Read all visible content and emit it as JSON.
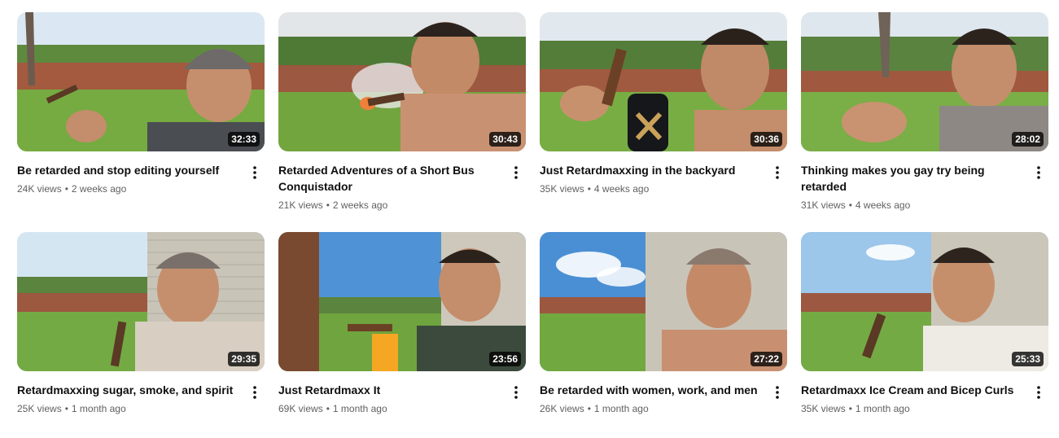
{
  "videos": [
    {
      "title": "Be retarded and stop editing yourself",
      "views": "24K views",
      "age": "2 weeks ago",
      "duration": "32:33",
      "scene": "fence"
    },
    {
      "title": "Retarded Adventures of a Short Bus Conquistador",
      "views": "21K views",
      "age": "2 weeks ago",
      "duration": "30:43",
      "scene": "fence"
    },
    {
      "title": "Just Retardmaxxing in the backyard",
      "views": "35K views",
      "age": "4 weeks ago",
      "duration": "30:36",
      "scene": "fence"
    },
    {
      "title": "Thinking makes you gay try being retarded",
      "views": "31K views",
      "age": "4 weeks ago",
      "duration": "28:02",
      "scene": "fence"
    },
    {
      "title": "Retardmaxxing sugar, smoke, and spirit",
      "views": "25K views",
      "age": "1 month ago",
      "duration": "29:35",
      "scene": "shed"
    },
    {
      "title": "Just Retardmaxx It",
      "views": "69K views",
      "age": "1 month ago",
      "duration": "23:56",
      "scene": "shed"
    },
    {
      "title": "Be retarded with women, work, and men",
      "views": "26K views",
      "age": "1 month ago",
      "duration": "27:22",
      "scene": "shed"
    },
    {
      "title": "Retardmaxx Ice Cream and Bicep Curls",
      "views": "35K views",
      "age": "1 month ago",
      "duration": "25:33",
      "scene": "shed"
    }
  ],
  "separator": "•",
  "colors": {
    "title": "#0f0f0f",
    "meta": "#606060",
    "duration_bg": "#000000",
    "sky": "#cfe3f2",
    "fence": "#a0583e",
    "grass": "#6fa83c",
    "shed": "#cfcabd"
  },
  "icons": {
    "more": "more-vert-icon"
  }
}
